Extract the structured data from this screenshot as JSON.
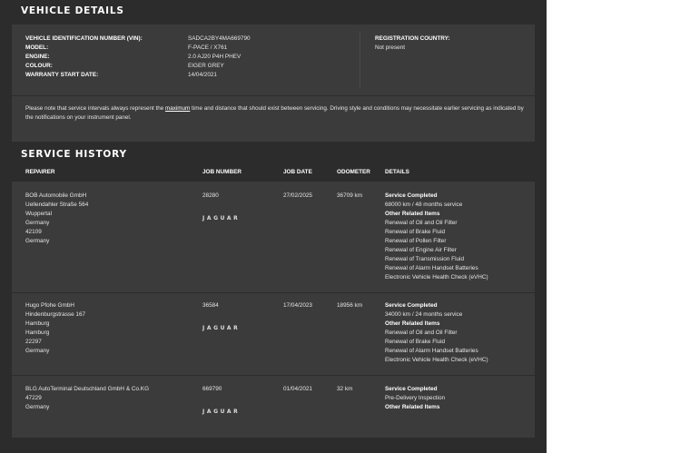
{
  "vehicle": {
    "title": "VEHICLE DETAILS",
    "fields": [
      {
        "label": "VEHICLE IDENTIFICATION NUMBER (VIN):",
        "value": "SADCA2BY4MA669790"
      },
      {
        "label": "MODEL:",
        "value": "F-PACE / X761"
      },
      {
        "label": "ENGINE:",
        "value": "2.0 AJ20 P4H PHEV"
      },
      {
        "label": "COLOUR:",
        "value": "EIGER GREY"
      },
      {
        "label": "WARRANTY START DATE:",
        "value": "14/04/2021"
      }
    ],
    "registration": {
      "label": "REGISTRATION COUNTRY:",
      "value": "Not present"
    }
  },
  "note": {
    "before": "Please note that service intervals always represent the ",
    "link": "maximum",
    "after": " time and distance that should exist between servicing. Driving style and conditions may necessitate earlier servicing as indicated by the notifications on your instrument panel."
  },
  "history": {
    "title": "SERVICE HISTORY",
    "headers": {
      "repairer": "REPAIRER",
      "job_number": "JOB NUMBER",
      "job_date": "JOB DATE",
      "odometer": "ODOMETER",
      "details": "DETAILS"
    },
    "brand_logo": "JAGUAR",
    "rows": [
      {
        "repairer": [
          "BOB Automobile GmbH",
          "Uellendahler Straße 564",
          "Wuppertal",
          "Germany",
          "42109",
          "Germany"
        ],
        "job_number": "28280",
        "job_date": "27/02/2025",
        "odometer": "36709 km",
        "service_heading": "Service Completed",
        "service": "68000 km / 48 months service",
        "related_heading": "Other Related Items",
        "items": [
          "Renewal of Oil and Oil Filter",
          "Renewal of Brake Fluid",
          "Renewal of Pollen Filter",
          "Renewal of Engine Air Filter",
          "Renewal of Transmission Fluid",
          "Renewal of Alarm Handset Batteries",
          "Electronic Vehicle Health Check (eVHC)"
        ]
      },
      {
        "repairer": [
          "Hugo Pfohe GmbH",
          "Hindenburgstrasse 167",
          "Hamburg",
          "Hamburg",
          "22297",
          "Germany"
        ],
        "job_number": "36584",
        "job_date": "17/04/2023",
        "odometer": "18956 km",
        "service_heading": "Service Completed",
        "service": "34000 km / 24 months service",
        "related_heading": "Other Related Items",
        "items": [
          "Renewal of Oil and Oil Filter",
          "Renewal of Brake Fluid",
          "Renewal of Alarm Handset Batteries",
          "Electronic Vehicle Health Check (eVHC)"
        ]
      },
      {
        "repairer": [
          "BLG AutoTerminal Deutschland GmbH & Co.KG",
          "47229",
          "Germany"
        ],
        "job_number": "669790",
        "job_date": "01/04/2021",
        "odometer": "32 km",
        "service_heading": "Service Completed",
        "service": "Pre-Delivery Inspection",
        "related_heading": "Other Related Items",
        "items": []
      }
    ]
  }
}
